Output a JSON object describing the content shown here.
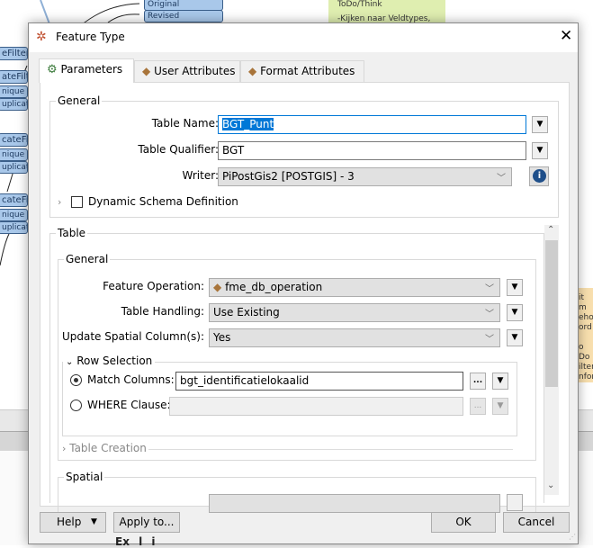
{
  "background": {
    "nodes": [
      "Original",
      "Revised",
      "eFilter",
      "ateFilter",
      "nique",
      "uplicate",
      "cateFilter",
      "nique",
      "uplicate",
      "cateFilter",
      "nique",
      "uplicate"
    ],
    "note_yellow": [
      "ToDo/Think",
      "-Kijken naar Veldtypes, bijna"
    ],
    "note_orange": [
      "it m",
      "eho",
      "ord",
      "",
      "o Do",
      "ilter",
      "nform",
      "omt"
    ],
    "bottom_text": "Ex l i"
  },
  "dialog": {
    "title": "Feature Type",
    "close_icon": "close-icon",
    "tabs": [
      {
        "label": "Parameters",
        "icon": "gear-icon"
      },
      {
        "label": "User Attributes",
        "icon": "arrow-right-icon"
      },
      {
        "label": "Format Attributes",
        "icon": "arrow-right-icon"
      }
    ],
    "general": {
      "title": "General",
      "table_name_label": "Table Name:",
      "table_name_value": "BGT_Punt",
      "table_qualifier_label": "Table Qualifier:",
      "table_qualifier_value": "BGT",
      "writer_label": "Writer:",
      "writer_value": "PiPostGis2 [POSTGIS] - 3",
      "dynamic_schema_label": "Dynamic Schema Definition",
      "dynamic_schema_checked": false
    },
    "table": {
      "title": "Table",
      "general_title": "General",
      "feature_operation_label": "Feature Operation:",
      "feature_operation_value": "fme_db_operation",
      "table_handling_label": "Table Handling:",
      "table_handling_value": "Use Existing",
      "update_spatial_label": "Update Spatial Column(s):",
      "update_spatial_value": "Yes",
      "row_selection_title": "Row Selection",
      "match_columns_label": "Match Columns:",
      "match_columns_value": "bgt_identificatielokaalid",
      "match_columns_selected": true,
      "where_clause_label": "WHERE Clause:",
      "where_clause_value": "",
      "ellipsis": "...",
      "table_creation_title": "Table Creation",
      "spatial_title": "Spatial"
    },
    "buttons": {
      "help": "Help",
      "apply_to": "Apply to...",
      "ok": "OK",
      "cancel": "Cancel"
    },
    "accent_color": "#0078d7"
  }
}
